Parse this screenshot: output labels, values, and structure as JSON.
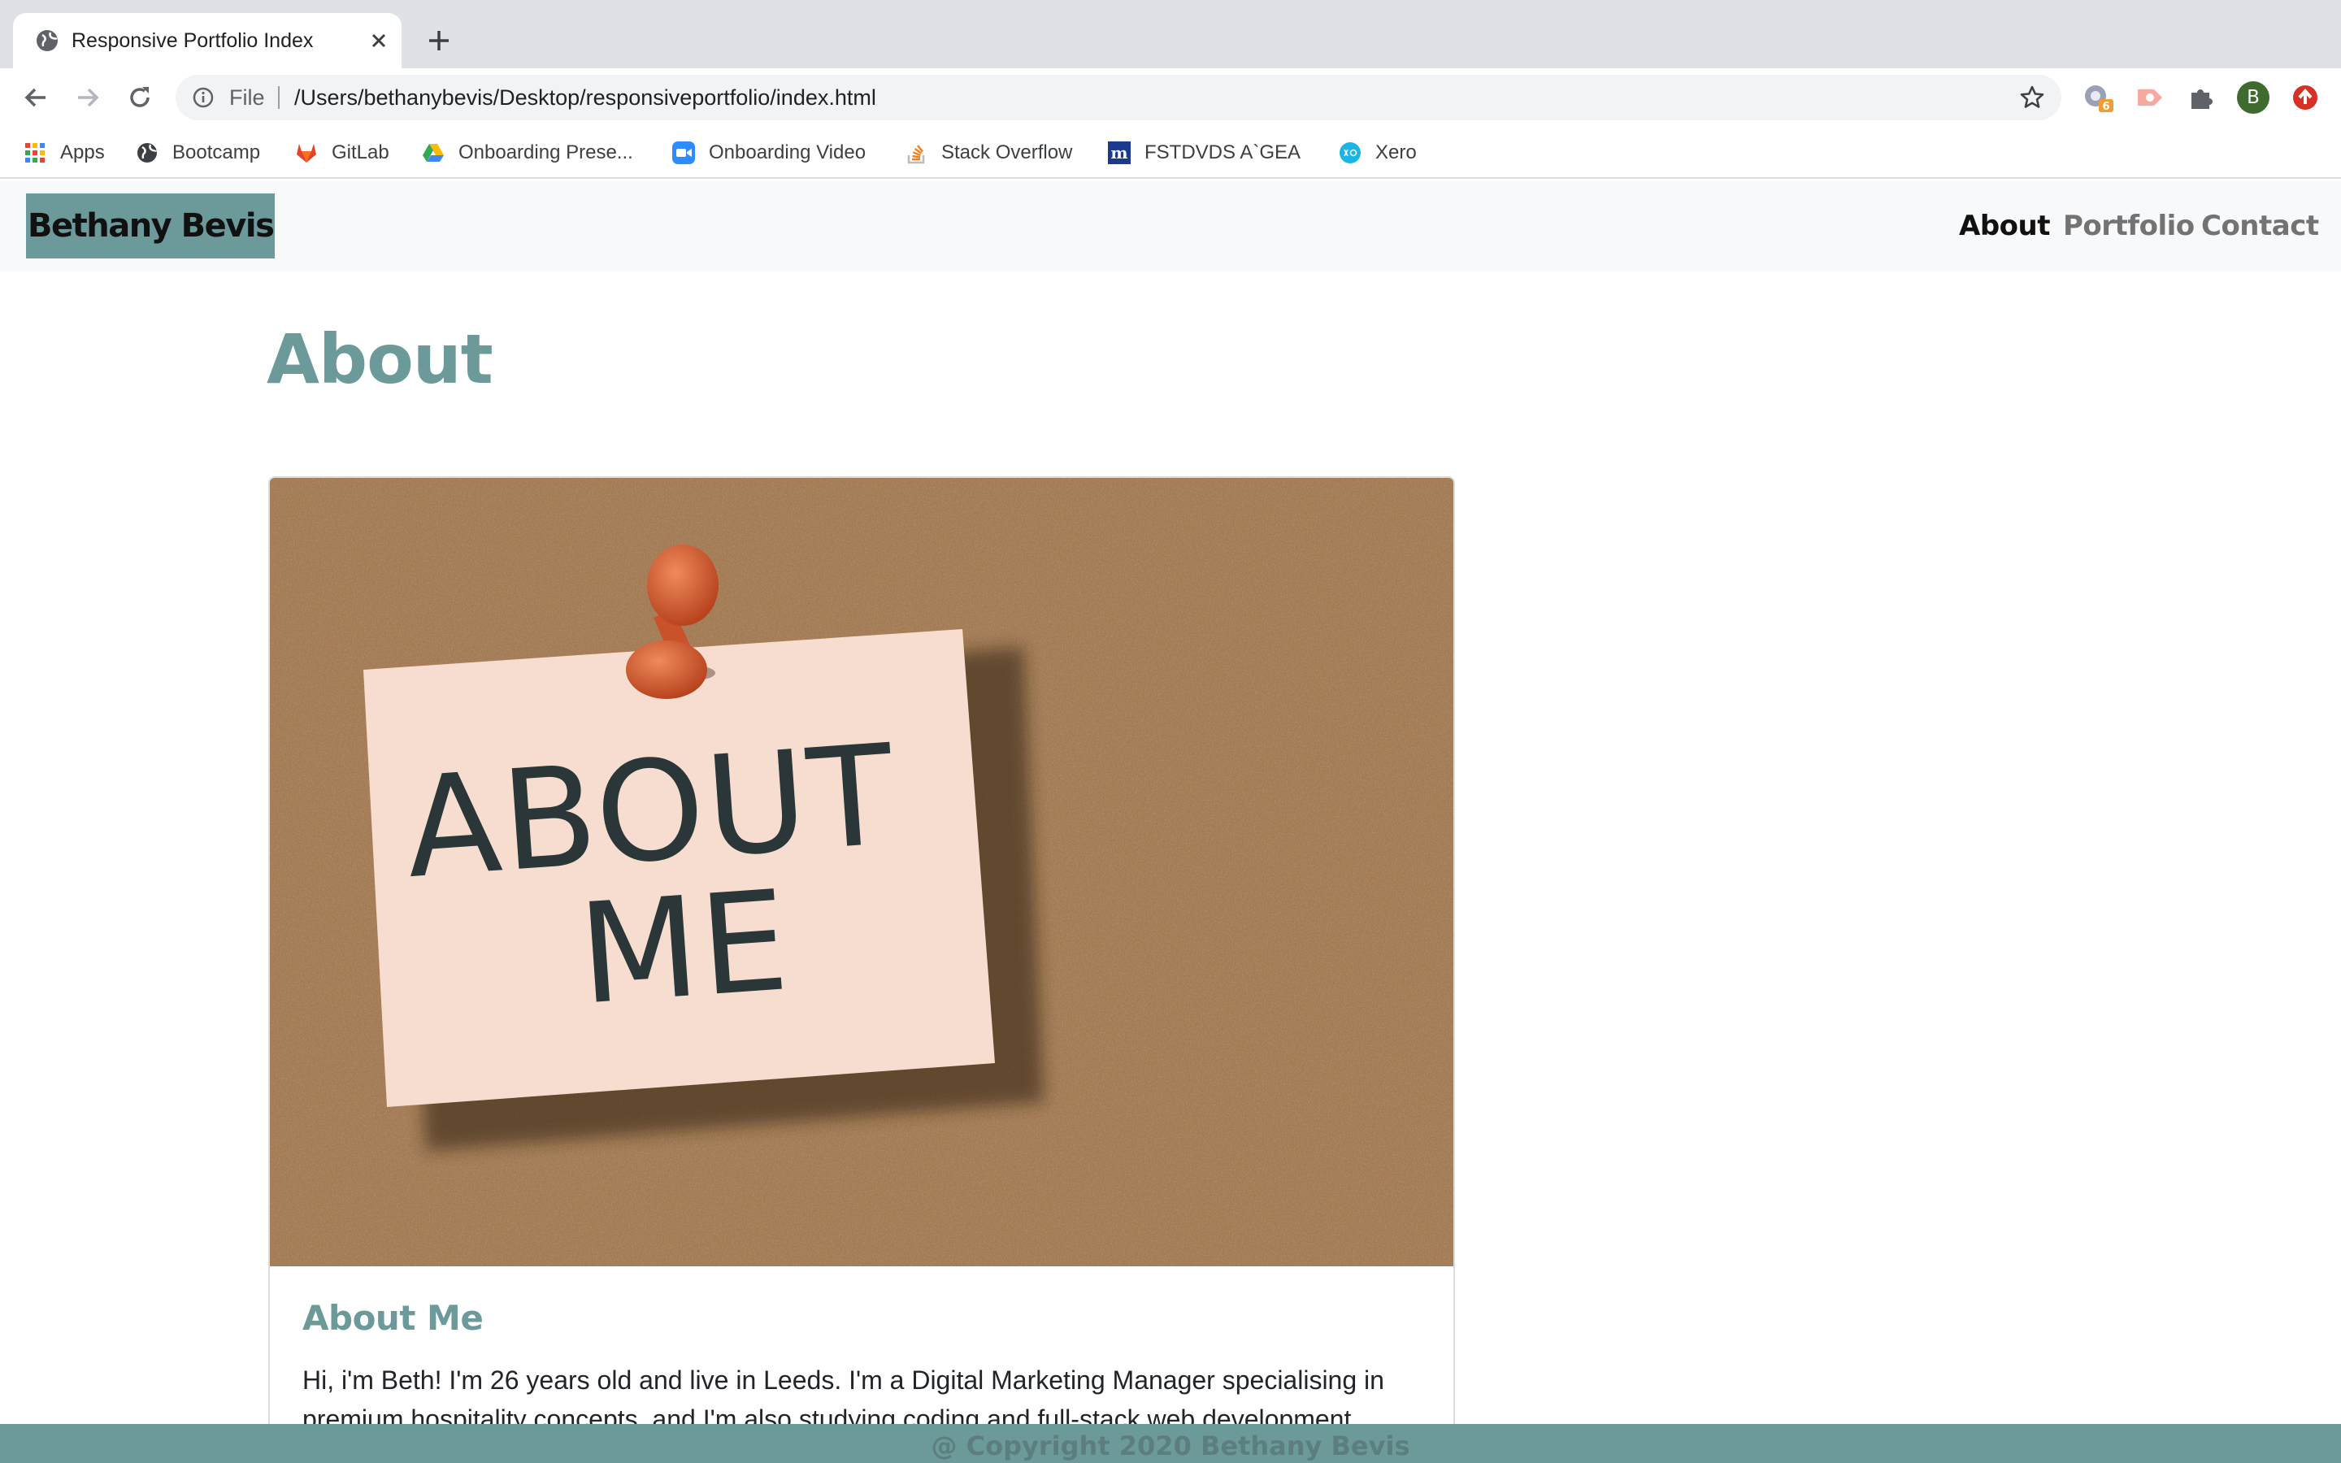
{
  "browser": {
    "tab": {
      "title": "Responsive Portfolio Index"
    },
    "omnibox": {
      "scheme": "File",
      "url": "/Users/bethanybevis/Desktop/responsiveportfolio/index.html"
    },
    "extensions": {
      "badge_count": "6",
      "profile_initial": "B"
    },
    "bookmarks": [
      {
        "label": "Apps",
        "icon": "apps-grid-icon"
      },
      {
        "label": "Bootcamp",
        "icon": "globe-icon"
      },
      {
        "label": "GitLab",
        "icon": "gitlab-icon"
      },
      {
        "label": "Onboarding Prese...",
        "icon": "google-drive-icon"
      },
      {
        "label": "Onboarding Video",
        "icon": "zoom-icon"
      },
      {
        "label": "Stack Overflow",
        "icon": "stack-overflow-icon"
      },
      {
        "label": "FSTDVDS A`GEA",
        "icon": "m-logo-icon"
      },
      {
        "label": "Xero",
        "icon": "xero-icon"
      }
    ]
  },
  "site": {
    "brand": "Bethany Bevis",
    "nav": {
      "about": "About",
      "portfolio": "Portfolio",
      "contact": "Contact"
    },
    "heading": "About",
    "card": {
      "image_lines": [
        "ABOUT",
        "ME"
      ],
      "title": "About Me",
      "text": "Hi, i'm Beth! I'm 26 years old and live in Leeds. I'm a Digital Marketing Manager specialising in premium hospitality concepts, and I'm also studying coding and full-stack web development."
    },
    "footer": "@ Copyright 2020 Bethany Bevis"
  },
  "colors": {
    "accent": "#6c9a9a",
    "tabstrip": "#dee1e6",
    "omnibox": "#f1f3f4",
    "navbar": "#f8f9fa",
    "cork": "#a47a53",
    "note": "#f6ddd0",
    "pin": "#d9572c"
  }
}
